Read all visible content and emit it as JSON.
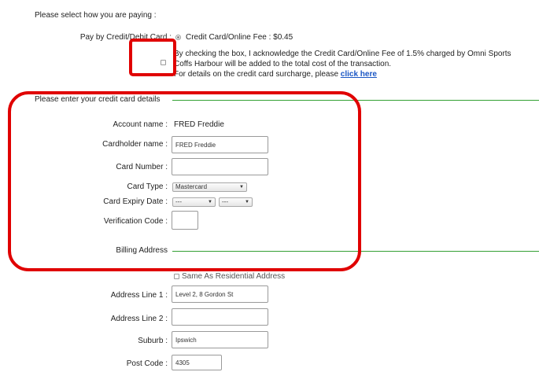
{
  "payment": {
    "heading": "Please select how you are paying :",
    "pay_by_label": "Pay by Credit/Debit Card :",
    "option_label": "Credit Card/Online Fee : $0.45",
    "ack_line1": "By checking the box, I acknowledge the Credit Card/Online Fee of 1.5% charged by Omni Sports",
    "ack_line2": "Coffs Harbour will be added to the total cost of the transaction.",
    "ack_line3_prefix": "For details on the credit card surcharge, please",
    "ack_link": "click here"
  },
  "card_details": {
    "legend": "Please enter your credit card details",
    "account_name_label": "Account name :",
    "account_name_value": "FRED Freddie",
    "cardholder_label": "Cardholder name :",
    "cardholder_value": "FRED Freddie",
    "card_number_label": "Card Number :",
    "card_number_value": "",
    "card_type_label": "Card Type :",
    "card_type_value": "Mastercard",
    "expiry_label": "Card Expiry Date :",
    "expiry_month": "---",
    "expiry_year": "---",
    "verification_label": "Verification Code :",
    "verification_value": ""
  },
  "billing": {
    "legend": "Billing Address",
    "same_as_label": "Same As Residential Address",
    "address1_label": "Address Line 1 :",
    "address1_value": "Level 2, 8 Gordon St",
    "address2_label": "Address Line 2 :",
    "address2_value": "",
    "suburb_label": "Suburb :",
    "suburb_value": "Ipswich",
    "postcode_label": "Post Code :",
    "postcode_value": "4305"
  },
  "colors": {
    "highlight": "#e00000",
    "legend_line": "#33a033",
    "link": "#1a56c4"
  }
}
